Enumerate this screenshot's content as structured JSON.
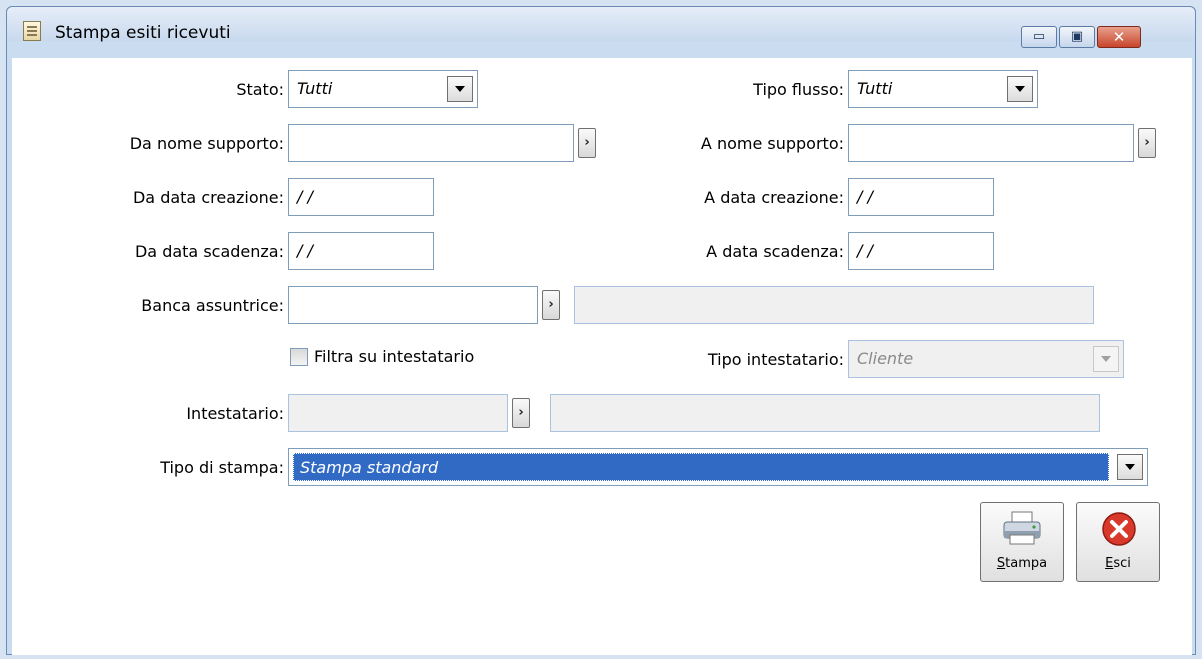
{
  "window": {
    "title": "Stampa esiti ricevuti",
    "minimize_glyph": "▭",
    "maximize_glyph": "▣",
    "close_glyph": "✕"
  },
  "form": {
    "stato_label": "Stato:",
    "stato_value": "Tutti",
    "tipo_flusso_label": "Tipo flusso:",
    "tipo_flusso_value": "Tutti",
    "da_nome_supporto_label": "Da nome supporto:",
    "a_nome_supporto_label": "A nome supporto:",
    "da_data_creazione_label": "Da data creazione:",
    "da_data_creazione_value": " /  /",
    "a_data_creazione_label": "A data creazione:",
    "a_data_creazione_value": " /  /",
    "da_data_scadenza_label": "Da data scadenza:",
    "da_data_scadenza_value": " /  /",
    "a_data_scadenza_label": "A data scadenza:",
    "a_data_scadenza_value": " /  /",
    "banca_assuntrice_label": "Banca assuntrice:",
    "filtra_label": "Filtra su intestatario",
    "tipo_intestatario_label": "Tipo intestatario:",
    "tipo_intestatario_value": "Cliente",
    "intestatario_label": "Intestatario:",
    "tipo_stampa_label": "Tipo di stampa:",
    "tipo_stampa_value": "Stampa standard",
    "zoom_glyph": "›"
  },
  "buttons": {
    "stampa_u": "S",
    "stampa_rest": "tampa",
    "esci_u": "E",
    "esci_rest": "sci"
  },
  "icons": {
    "app": "document-icon",
    "print": "printer-icon",
    "exit": "exit-icon"
  }
}
